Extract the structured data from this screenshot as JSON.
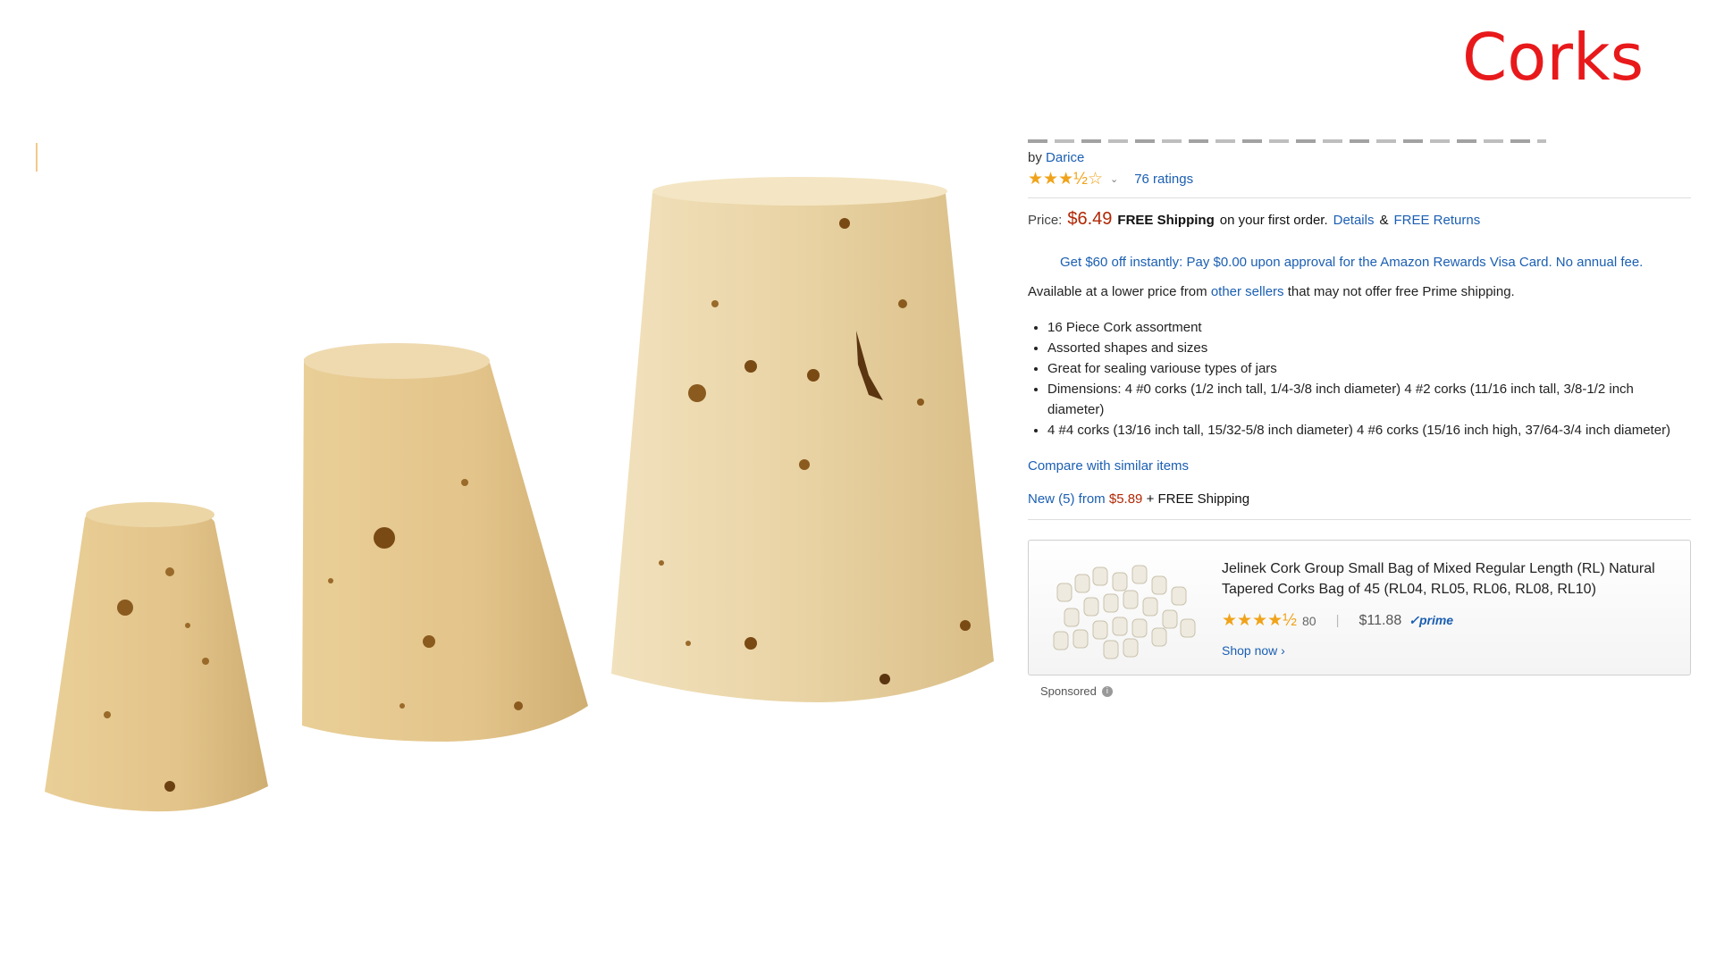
{
  "slide": {
    "title": "Corks"
  },
  "product": {
    "by_prefix": "by",
    "brand": "Darice",
    "stars_display": "★★★½☆",
    "rating_value": 3.5,
    "ratings_text": "76 ratings",
    "price_label": "Price:",
    "price": "$6.49",
    "free_shipping": "FREE Shipping",
    "shipping_suffix": "on your first order.",
    "details_link": "Details",
    "amp": "&",
    "returns_link": "FREE Returns",
    "promo": "Get $60 off instantly: Pay $0.00 upon approval for the Amazon Rewards Visa Card. No annual fee.",
    "available_prefix": "Available at a lower price from",
    "other_sellers": "other sellers",
    "available_suffix": "that may not offer free Prime shipping.",
    "bullets": [
      "16 Piece Cork assortment",
      "Assorted shapes and sizes",
      "Great for sealing variouse types of jars",
      "Dimensions: 4 #0 corks (1/2 inch tall, 1/4-3/8 inch diameter) 4 #2 corks (11/16 inch tall, 3/8-1/2 inch diameter)",
      "4 #4 corks (13/16 inch tall, 15/32-5/8 inch diameter) 4 #6 corks (15/16 inch high, 37/64-3/4 inch diameter)"
    ],
    "compare_link": "Compare with similar items",
    "new_prefix": "New (5) from",
    "new_price": "$5.89",
    "new_suffix": "+ FREE Shipping"
  },
  "sponsored": {
    "title": "Jelinek Cork Group Small Bag of Mixed Regular Length (RL) Natural Tapered Corks Bag of 45 (RL04, RL05, RL06, RL08, RL10)",
    "stars_display": "★★★★½",
    "rating_value": 4.5,
    "review_count": "80",
    "separator": "|",
    "price": "$11.88",
    "prime": "✓prime",
    "shop_now": "Shop now ›",
    "label": "Sponsored",
    "info_icon": "i"
  },
  "colors": {
    "title_red": "#e8191b",
    "link_blue": "#1b5fb3",
    "price_red": "#b12704",
    "star_orange": "#f0a31a",
    "cork": "#e6cf9e"
  }
}
